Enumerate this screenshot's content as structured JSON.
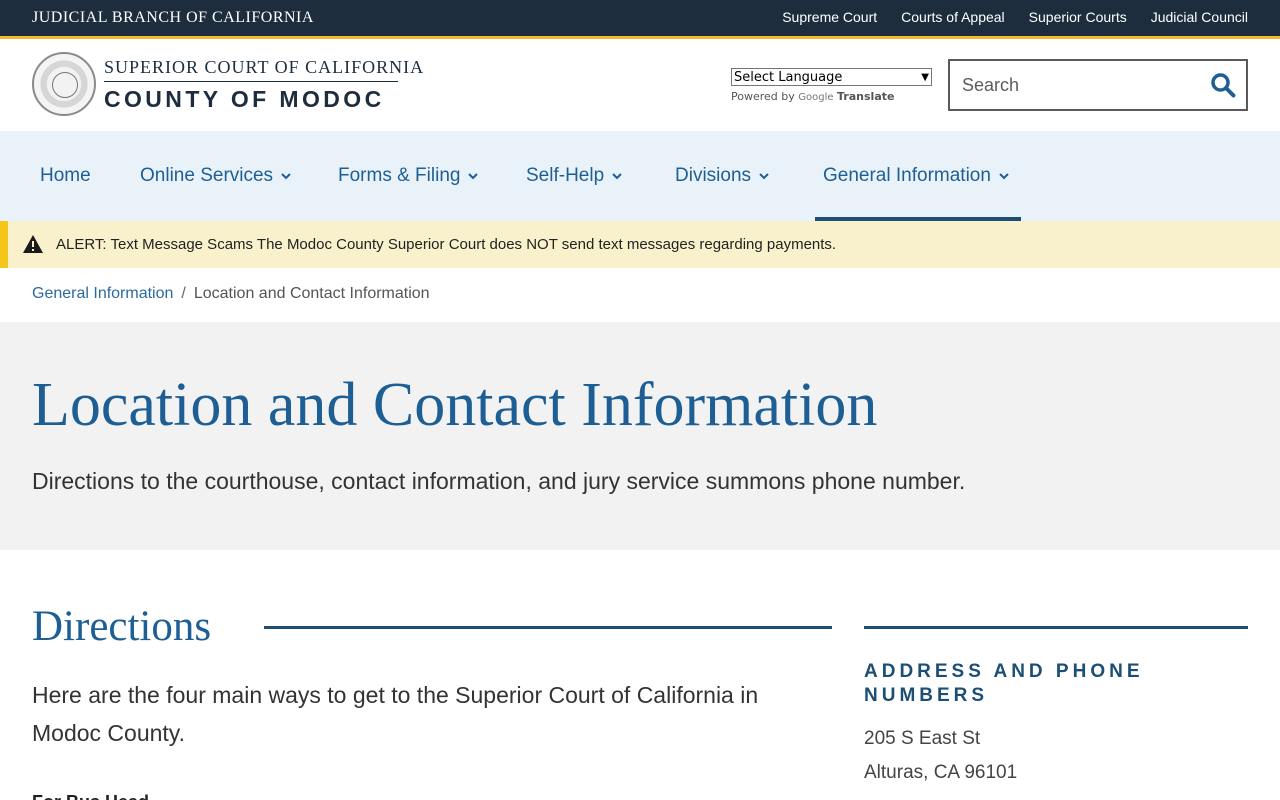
{
  "topbar": {
    "branch": "JUDICIAL BRANCH OF CALIFORNIA",
    "links": [
      "Supreme Court",
      "Courts of Appeal",
      "Superior Courts",
      "Judicial Council"
    ]
  },
  "header": {
    "court_line1": "SUPERIOR COURT OF CALIFORNIA",
    "court_line2": "COUNTY OF MODOC",
    "language_select": "Select Language",
    "powered_by": "Powered by",
    "google": "Google",
    "translate": "Translate",
    "search_placeholder": "Search"
  },
  "nav": {
    "items": [
      {
        "label": "Home"
      },
      {
        "label": "Online Services"
      },
      {
        "label": "Forms & Filing"
      },
      {
        "label": "Self-Help"
      },
      {
        "label": "Divisions"
      },
      {
        "label": "General Information"
      }
    ],
    "active": "General Information"
  },
  "alert": {
    "text": "ALERT: Text Message Scams The Modoc County Superior Court does NOT send text messages regarding payments."
  },
  "breadcrumb": {
    "parent": "General Information",
    "separator": "/",
    "current": "Location and Contact Information"
  },
  "hero": {
    "title": "Location and Contact Information",
    "subtitle": "Directions to the courthouse, contact information, and jury service summons phone number."
  },
  "main": {
    "directions_title": "Directions",
    "intro": "Here are the four main ways to get to the Superior Court of California in Modoc County.",
    "subhead": "For Bus Head..."
  },
  "sidebar": {
    "title": "ADDRESS AND PHONE NUMBERS",
    "address_line1": "205 S East St",
    "address_line2": "Alturas, CA 96101"
  },
  "colors": {
    "topbar": "#1d2d3e",
    "accent": "#f5b82e",
    "link_blue": "#1d5f95",
    "nav_bg": "#eaf2f9",
    "alert_bg": "#f9f1cc",
    "hero_bg": "#f2f2f2"
  }
}
